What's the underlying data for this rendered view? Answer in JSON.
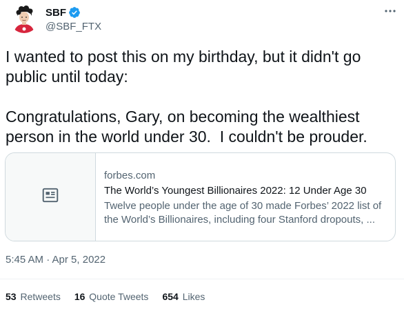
{
  "user": {
    "name": "SBF",
    "handle": "@SBF_FTX",
    "verified": true
  },
  "tweet": {
    "text": "I wanted to post this on my birthday, but it didn't go public until today:\n\nCongratulations, Gary, on becoming the wealthiest person in the world under 30.  I couldn't be prouder.",
    "timestamp": "5:45 AM · Apr 5, 2022"
  },
  "card": {
    "domain": "forbes.com",
    "title": "The World’s Youngest Billionaires 2022: 12 Under Age 30",
    "description": "Twelve people under the age of 30 made Forbes’ 2022 list of the World’s Billionaires, including four Stanford dropouts, ...",
    "icon": "article-icon"
  },
  "stats": {
    "retweets_count": "53",
    "retweets_label": "Retweets",
    "quotes_count": "16",
    "quotes_label": "Quote Tweets",
    "likes_count": "654",
    "likes_label": "Likes"
  },
  "colors": {
    "verified_blue": "#1d9bf0",
    "secondary_text": "#536471",
    "border": "#cfd9de"
  }
}
